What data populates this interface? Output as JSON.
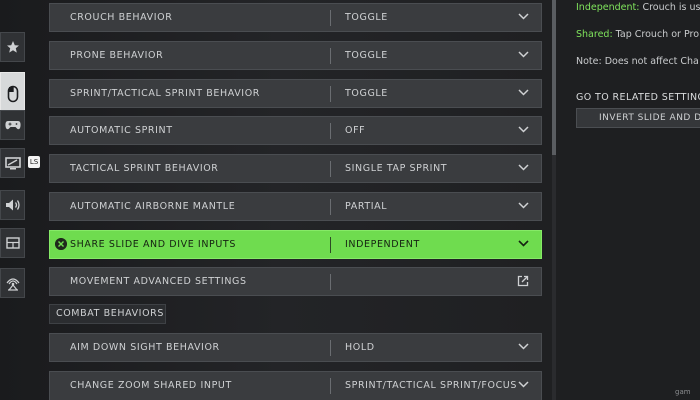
{
  "rail": {
    "items": [
      {
        "name": "favorites",
        "icon": "star-icon",
        "active": false
      },
      {
        "name": "mouse",
        "icon": "mouse-icon",
        "active": true
      },
      {
        "name": "controller",
        "icon": "gamepad-icon",
        "active": false
      },
      {
        "name": "graphics",
        "icon": "monitor-icon",
        "active": false
      },
      {
        "name": "audio",
        "icon": "speaker-icon",
        "active": false
      },
      {
        "name": "interface",
        "icon": "layout-icon",
        "active": false
      },
      {
        "name": "account",
        "icon": "network-icon",
        "active": false
      }
    ]
  },
  "cursor_tag": "LS",
  "settings": {
    "rows": [
      {
        "label": "CROUCH BEHAVIOR",
        "value": "TOGGLE"
      },
      {
        "label": "PRONE BEHAVIOR",
        "value": "TOGGLE"
      },
      {
        "label": "SPRINT/TACTICAL SPRINT BEHAVIOR",
        "value": "TOGGLE"
      },
      {
        "label": "AUTOMATIC SPRINT",
        "value": "OFF"
      },
      {
        "label": "TACTICAL SPRINT BEHAVIOR",
        "value": "SINGLE TAP SPRINT"
      },
      {
        "label": "AUTOMATIC AIRBORNE MANTLE",
        "value": "PARTIAL"
      },
      {
        "label": "SHARE SLIDE AND DIVE INPUTS",
        "value": "INDEPENDENT"
      },
      {
        "label": "MOVEMENT ADVANCED SETTINGS",
        "value": ""
      }
    ],
    "section_title": "COMBAT BEHAVIORS",
    "combat_rows": [
      {
        "label": "AIM DOWN SIGHT BEHAVIOR",
        "value": "HOLD"
      },
      {
        "label": "CHANGE ZOOM SHARED INPUT",
        "value": "SPRINT/TACTICAL SPRINT/FOCUS"
      }
    ]
  },
  "info_panel": {
    "line1_kw": "Independent:",
    "line1_rest": " Crouch is us",
    "line2_kw": "Shared:",
    "line2_rest": " Tap Crouch or Pro",
    "line3": "Note: Does not affect Cha",
    "related_title": "GO TO RELATED SETTINGS",
    "related_button": "INVERT SLIDE AND DIVE"
  },
  "watermark": "gam",
  "colors": {
    "highlight": "#6fdc4f",
    "keyword_green": "#7fe35c",
    "row_bg": "#3a3c3f"
  }
}
